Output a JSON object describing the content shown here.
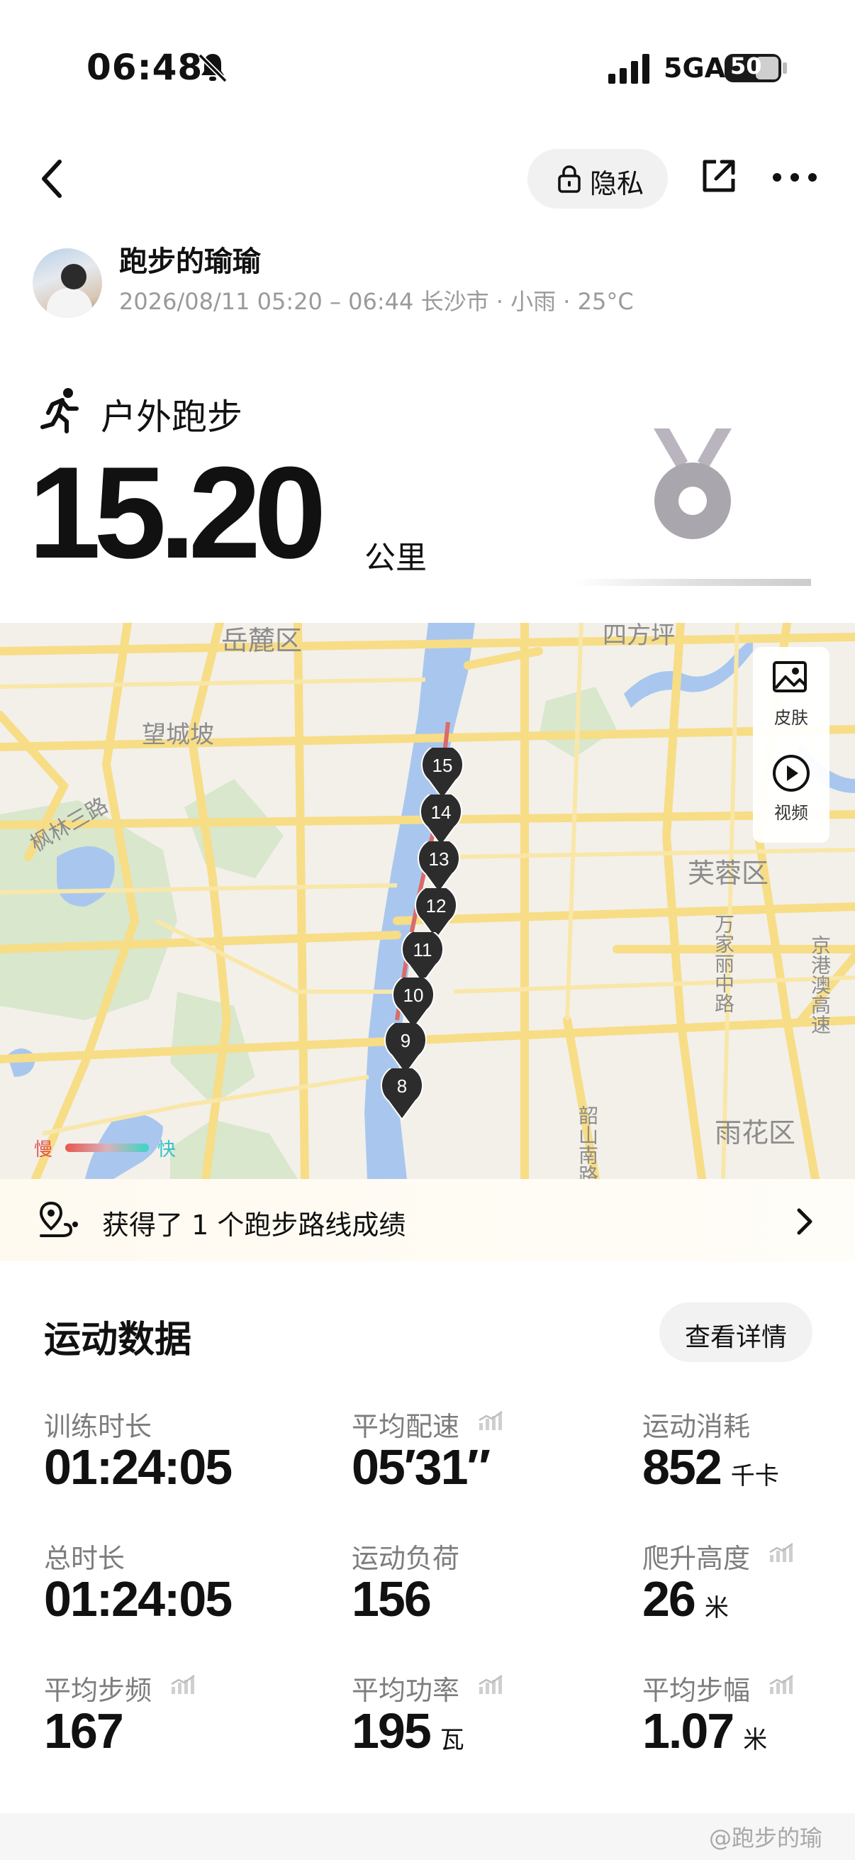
{
  "status_bar": {
    "time": "06:48",
    "network": "5GA",
    "battery": "50"
  },
  "header": {
    "privacy_label": "隐私"
  },
  "user": {
    "name": "跑步的瑜瑜",
    "meta": "2026/08/11 05:20 – 06:44 长沙市 · 小雨 · 25°C"
  },
  "activity": {
    "type": "户外跑步",
    "distance": "15.20",
    "distance_unit": "公里"
  },
  "map": {
    "labels": {
      "yuelu": "岳麓区",
      "wangcheng": "望城坡",
      "fenglin": "枫林三路",
      "sifangping": "四方坪",
      "furong": "芙蓉区",
      "yuhua": "雨花区",
      "wanjiali": "万家丽中路",
      "jinggang": "京港澳高速",
      "shaoshan": "韶山南路"
    },
    "tools": {
      "skin": "皮肤",
      "video": "视频"
    },
    "legend": {
      "slow": "慢",
      "fast": "快"
    },
    "km_markers": [
      "15",
      "14",
      "13",
      "12",
      "11",
      "10",
      "9",
      "8"
    ],
    "colors": {
      "water": "#a9c7ee",
      "road": "#f7dd86",
      "park": "#d6e6c8",
      "pin": "#2c2c2c",
      "start": "#2ecf72"
    }
  },
  "achievement": {
    "label": "获得了 1 个跑步路线成绩"
  },
  "stats": {
    "title": "运动数据",
    "details_label": "查看详情",
    "training_duration": {
      "label": "训练时长",
      "value": "01:24:05"
    },
    "avg_pace": {
      "label": "平均配速",
      "value": "05′31″"
    },
    "calories": {
      "label": "运动消耗",
      "value": "852",
      "unit": "千卡"
    },
    "total_duration": {
      "label": "总时长",
      "value": "01:24:05"
    },
    "training_load": {
      "label": "运动负荷",
      "value": "156"
    },
    "elevation_gain": {
      "label": "爬升高度",
      "value": "26",
      "unit": "米"
    },
    "avg_cadence": {
      "label": "平均步频",
      "value": "167"
    },
    "avg_power": {
      "label": "平均功率",
      "value": "195",
      "unit": "瓦"
    },
    "avg_stride": {
      "label": "平均步幅",
      "value": "1.07",
      "unit": "米"
    }
  },
  "watermark": "@跑步的瑜"
}
